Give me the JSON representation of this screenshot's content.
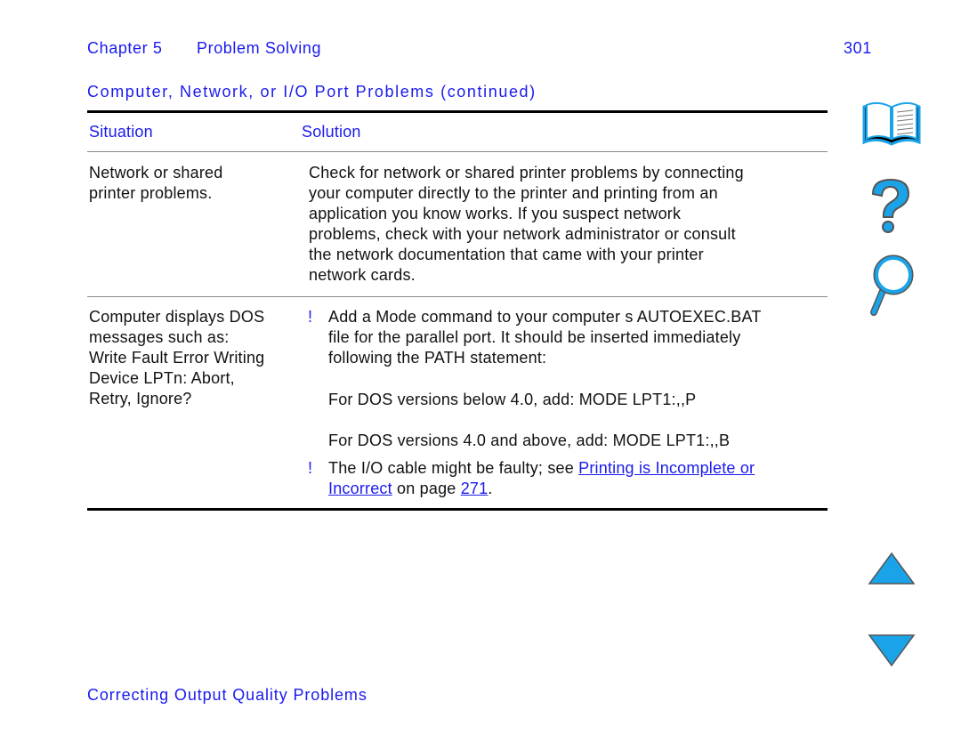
{
  "header": {
    "chapter": "Chapter 5",
    "title": "Problem Solving",
    "page": "301"
  },
  "section_title": "Computer, Network, or I/O Port Problems (continued)",
  "table": {
    "headers": [
      "Situation",
      "Solution"
    ],
    "rows": [
      {
        "situation": [
          "Network or shared",
          "printer problems."
        ],
        "solution": [
          "Check for network or shared printer problems by connecting",
          "your computer directly to the printer and printing from an",
          "application you know works. If you suspect network",
          "problems, check with your network administrator or consult",
          "the network documentation that came with your printer",
          "network cards."
        ]
      },
      {
        "situation": [
          "Computer displays DOS",
          "messages such as:",
          "Write Fault Error Writing",
          "Device LPTn: Abort,",
          "Retry, Ignore?"
        ],
        "bullet": "!",
        "solution1": [
          "Add a Mode command to your computer s AUTOEXEC.BAT",
          "file for the parallel port. It should be inserted immediately",
          "following the PATH statement:"
        ],
        "dos_below": "For DOS versions below 4.0, add: MODE LPT1:,,P",
        "dos_above": "For DOS versions 4.0 and above, add: MODE LPT1:,,B",
        "solution2_prefix": "The I/O cable might be faulty; see ",
        "link1a": "Printing is Incomplete or ",
        "link1b": "Incorrect",
        "on_page": " on page ",
        "page_link": "271",
        "period": "."
      }
    ]
  },
  "footer_link": "Correcting Output Quality Problems",
  "nav_icons": [
    "book-icon",
    "help-icon",
    "search-icon",
    "previous-page-icon",
    "next-page-icon"
  ],
  "colors": {
    "text_blue": "#1a1aee",
    "icon_blue": "#1aa3e8"
  }
}
